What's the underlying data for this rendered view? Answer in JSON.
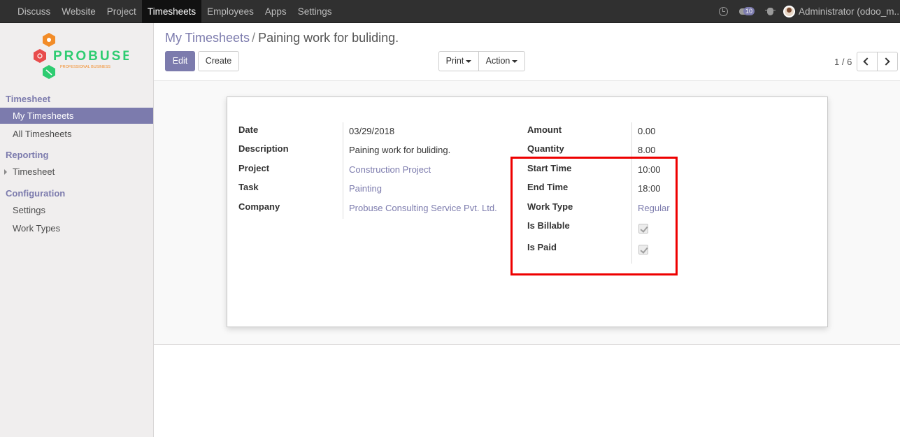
{
  "topbar": {
    "menu": [
      "Discuss",
      "Website",
      "Project",
      "Timesheets",
      "Employees",
      "Apps",
      "Settings"
    ],
    "active": "Timesheets",
    "chat_count": "10",
    "user": "Administrator (odoo_m..."
  },
  "logo": {
    "brand": "PROBUSE",
    "tagline": "PROFESSIONAL BUSINESS"
  },
  "sidebar": {
    "sections": [
      {
        "title": "Timesheet",
        "items": [
          "My Timesheets",
          "All Timesheets"
        ]
      },
      {
        "title": "Reporting",
        "items": [
          "Timesheet"
        ]
      },
      {
        "title": "Configuration",
        "items": [
          "Settings",
          "Work Types"
        ]
      }
    ],
    "active_item": "My Timesheets"
  },
  "breadcrumb": {
    "parent": "My Timesheets",
    "separator": "/",
    "current": "Paining work for buliding."
  },
  "buttons": {
    "edit": "Edit",
    "create": "Create",
    "print": "Print",
    "action": "Action"
  },
  "pager": {
    "text": "1 / 6"
  },
  "form": {
    "left": [
      {
        "label": "Date",
        "value": "03/29/2018",
        "link": false
      },
      {
        "label": "Description",
        "value": "Paining work for buliding.",
        "link": false
      },
      {
        "label": "Project",
        "value": "Construction Project",
        "link": true
      },
      {
        "label": "Task",
        "value": "Painting",
        "link": true
      },
      {
        "label": "Company",
        "value": "Probuse Consulting Service Pvt. Ltd.",
        "link": true
      }
    ],
    "right": [
      {
        "label": "Amount",
        "value": "0.00"
      },
      {
        "label": "Quantity",
        "value": "8.00"
      },
      {
        "label": "Start Time",
        "value": "10:00"
      },
      {
        "label": "End Time",
        "value": "18:00"
      },
      {
        "label": "Work Type",
        "value": "Regular"
      },
      {
        "label": "Is Billable",
        "checked": true
      },
      {
        "label": "Is Paid",
        "checked": true
      }
    ]
  },
  "colors": {
    "brand": "#7c7bad",
    "highlight": "#ee0000",
    "topbar": "#303030"
  }
}
